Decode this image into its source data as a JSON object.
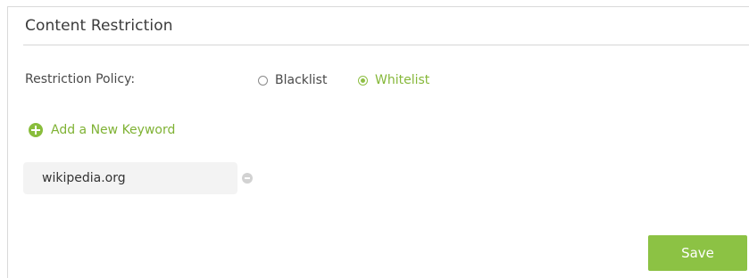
{
  "section": {
    "title": "Content Restriction"
  },
  "policy": {
    "label": "Restriction Policy:",
    "options": [
      {
        "label": "Blacklist",
        "selected": false
      },
      {
        "label": "Whitelist",
        "selected": true
      }
    ]
  },
  "keywords": {
    "add_label": "Add a New Keyword",
    "items": [
      {
        "value": "wikipedia.org"
      }
    ]
  },
  "actions": {
    "save_label": "Save"
  },
  "colors": {
    "accent": "#8cc244",
    "selected_text": "#86b83a",
    "text": "#4a4a4a"
  },
  "icons": {
    "add": "plus-circle-icon",
    "remove": "minus-circle-icon"
  }
}
